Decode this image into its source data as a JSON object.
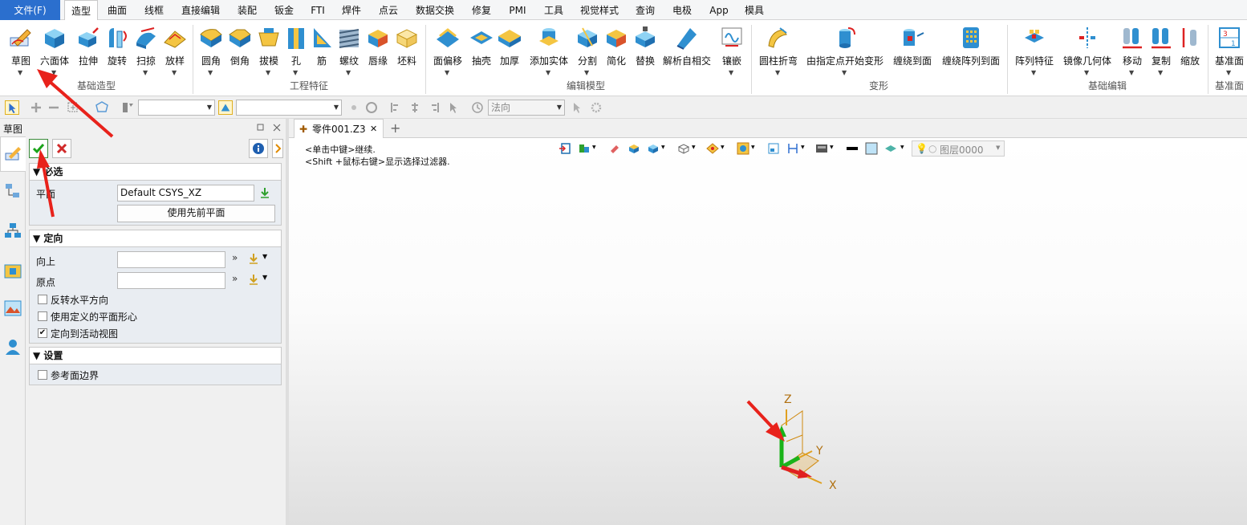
{
  "menubar": {
    "file": "文件(F)",
    "items": [
      "造型",
      "曲面",
      "线框",
      "直接编辑",
      "装配",
      "钣金",
      "FTI",
      "焊件",
      "点云",
      "数据交换",
      "修复",
      "PMI",
      "工具",
      "视觉样式",
      "查询",
      "电极",
      "App",
      "模具"
    ],
    "active": "造型"
  },
  "ribbon": {
    "buttons": [
      "草图",
      "六面体",
      "拉伸",
      "旋转",
      "扫掠",
      "放样",
      "圆角",
      "倒角",
      "拔模",
      "孔",
      "筋",
      "螺纹",
      "唇缘",
      "坯料",
      "面偏移",
      "抽壳",
      "加厚",
      "添加实体",
      "分割",
      "简化",
      "替换",
      "解析自相交",
      "镶嵌",
      "圆柱折弯",
      "由指定点开始变形",
      "缠绕到面",
      "缠绕阵列到面",
      "阵列特征",
      "镜像几何体",
      "移动",
      "复制",
      "缩放",
      "基准面"
    ],
    "groups": [
      "基础造型",
      "工程特征",
      "编辑模型",
      "变形",
      "基础编辑",
      "基准面"
    ]
  },
  "toolbar": {
    "view_direction": "法向"
  },
  "panel": {
    "title": "草图",
    "required_section": "必选",
    "plane_label": "平面",
    "plane_value": "Default CSYS_XZ",
    "use_prev_plane": "使用先前平面",
    "orient_section": "定向",
    "up_label": "向上",
    "origin_label": "原点",
    "reverse_h": "反转水平方向",
    "use_defined_center": "使用定义的平面形心",
    "orient_active_view": "定向到活动视图",
    "settings_section": "设置",
    "ref_face_boundary": "参考面边界",
    "checks": {
      "reverse_h": false,
      "use_defined_center": false,
      "orient_active_view": true,
      "ref_face_boundary": false
    }
  },
  "document": {
    "tab": "零件001.Z3",
    "hint1": "<单击中键>继续.",
    "hint2": "<Shift +鼠标右键>显示选择过滤器.",
    "layer": "图层0000",
    "axes": {
      "x": "X",
      "y": "Y",
      "z": "Z"
    }
  },
  "colors": {
    "accent": "#2b6fce",
    "annotation_arrow": "#e8221b",
    "axis_x": "#e02020",
    "axis_y": "#22b14c",
    "axis_z": "#e0a020"
  }
}
